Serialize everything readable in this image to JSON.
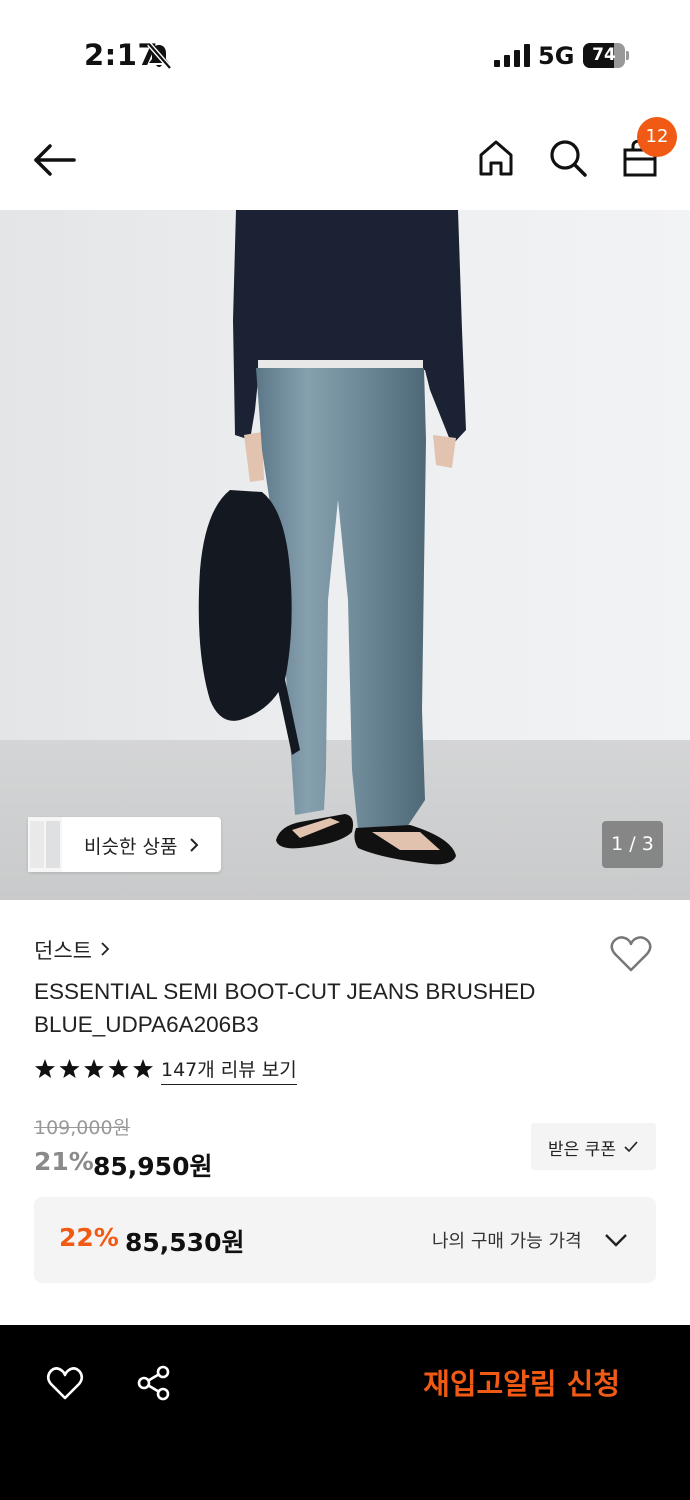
{
  "status_bar": {
    "time": "2:17",
    "network": "5G",
    "battery": "74",
    "battery_level": 0.74,
    "icons": [
      "bell-off-icon",
      "signal-icon",
      "battery-icon"
    ]
  },
  "header": {
    "icons": [
      "back-arrow-icon",
      "home-icon",
      "search-icon",
      "shopping-bag-icon"
    ],
    "cart_count": "12",
    "badge_color": "#f15a14"
  },
  "gallery": {
    "similar_label": "비슷한 상품",
    "counter": "1 / 3"
  },
  "product": {
    "brand": "던스트",
    "title": "ESSENTIAL SEMI BOOT-CUT JEANS BRUSHED BLUE_UDPA6A206B3",
    "rating_stars": 5,
    "review_link": "147개 리뷰 보기",
    "original_price": "109,000원",
    "discount_rate": "21%",
    "sale_price": "85,950원",
    "coupon_label": "받은 쿠폰"
  },
  "best_price": {
    "rate": "22%",
    "price": "85,530원",
    "label": "나의 구매 가능 가격"
  },
  "bottom_bar": {
    "restock_label": "재입고알림 신청",
    "accent_color": "#f15a14",
    "icons": [
      "heart-icon",
      "share-icon"
    ]
  }
}
